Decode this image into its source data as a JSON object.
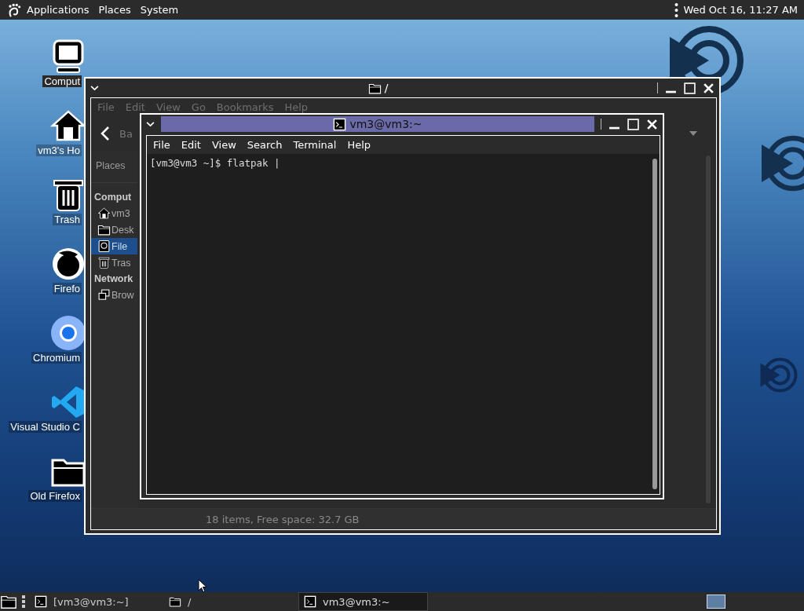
{
  "top_panel": {
    "menus": [
      "Applications",
      "Places",
      "System"
    ],
    "clock": "Wed Oct 16, 11:27 AM"
  },
  "desktop_icons": [
    {
      "kind": "computer",
      "label": "Comput",
      "selected": true
    },
    {
      "kind": "home",
      "label": "vm3's Ho",
      "selected": false
    },
    {
      "kind": "trash",
      "label": "Trash",
      "selected": false
    },
    {
      "kind": "firefox",
      "label": "Firefo",
      "selected": false
    },
    {
      "kind": "chromium",
      "label": "Chromium",
      "selected": false
    },
    {
      "kind": "vscode",
      "label": "Visual Studio C",
      "selected": false
    },
    {
      "kind": "folder",
      "label": "Old Firefox",
      "selected": false
    }
  ],
  "file_manager": {
    "title": "/",
    "menus": [
      "File",
      "Edit",
      "View",
      "Go",
      "Bookmarks",
      "Help"
    ],
    "back_label": "Ba",
    "places_label": "Places",
    "sidebar": [
      {
        "heading": "Comput",
        "items": [
          {
            "kind": "home",
            "label": "vm3",
            "selected": false
          },
          {
            "kind": "folder",
            "label": "Desk",
            "selected": false
          },
          {
            "kind": "drive",
            "label": "File",
            "selected": true
          },
          {
            "kind": "trash",
            "label": "Tras",
            "selected": false
          }
        ]
      },
      {
        "heading": "Network",
        "items": [
          {
            "kind": "network",
            "label": "Brow",
            "selected": false
          }
        ]
      }
    ],
    "status": "18 items, Free space: 32.7 GB"
  },
  "terminal": {
    "title": "vm3@vm3:~",
    "menus": [
      "File",
      "Edit",
      "View",
      "Search",
      "Terminal",
      "Help"
    ],
    "lines": [
      "[vm3@vm3 ~]$ flatpak |"
    ]
  },
  "taskbar": {
    "tasks": [
      {
        "kind": "terminal",
        "label": "[vm3@vm3:~]",
        "selected": false
      },
      {
        "kind": "folder",
        "label": "/",
        "selected": false
      },
      {
        "kind": "terminal",
        "label": "vm3@vm3:~",
        "selected": true
      }
    ]
  }
}
